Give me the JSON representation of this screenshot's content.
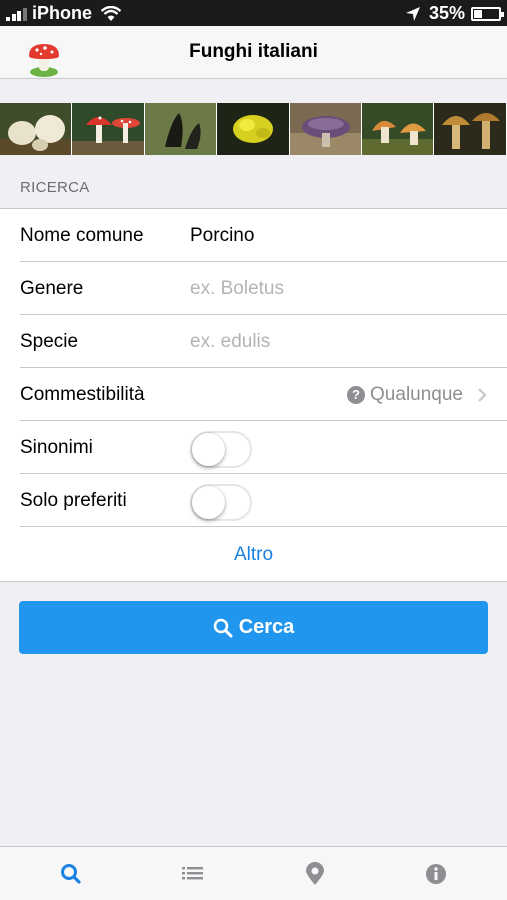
{
  "status_bar": {
    "carrier": "iPhone",
    "battery_percent": "35%",
    "battery_level": 0.35
  },
  "nav": {
    "title": "Funghi italiani"
  },
  "photos": [
    "porcini",
    "amanita",
    "dark-fungus",
    "yellow-fungus",
    "purple-cap",
    "orange-cap",
    "brown-cap"
  ],
  "search_section": {
    "header": "RICERCA",
    "common_name": {
      "label": "Nome comune",
      "value": "Porcino"
    },
    "genus": {
      "label": "Genere",
      "placeholder": "ex. Boletus"
    },
    "species": {
      "label": "Specie",
      "placeholder": "ex. edulis"
    },
    "edibility": {
      "label": "Commestibilità",
      "value": "Qualunque"
    },
    "synonyms": {
      "label": "Sinonimi",
      "on": false
    },
    "favorites_only": {
      "label": "Solo preferiti",
      "on": false
    },
    "more_link": "Altro"
  },
  "search_button": {
    "label": "Cerca"
  },
  "tabs": [
    {
      "icon": "search-icon",
      "active": true
    },
    {
      "icon": "list-icon",
      "active": false
    },
    {
      "icon": "map-pin-icon",
      "active": false
    },
    {
      "icon": "info-icon",
      "active": false
    }
  ],
  "colors": {
    "accent": "#2196ee",
    "link": "#1a82e2",
    "tab_active": "#1a82e2",
    "tab_inactive": "#8e8e93"
  }
}
